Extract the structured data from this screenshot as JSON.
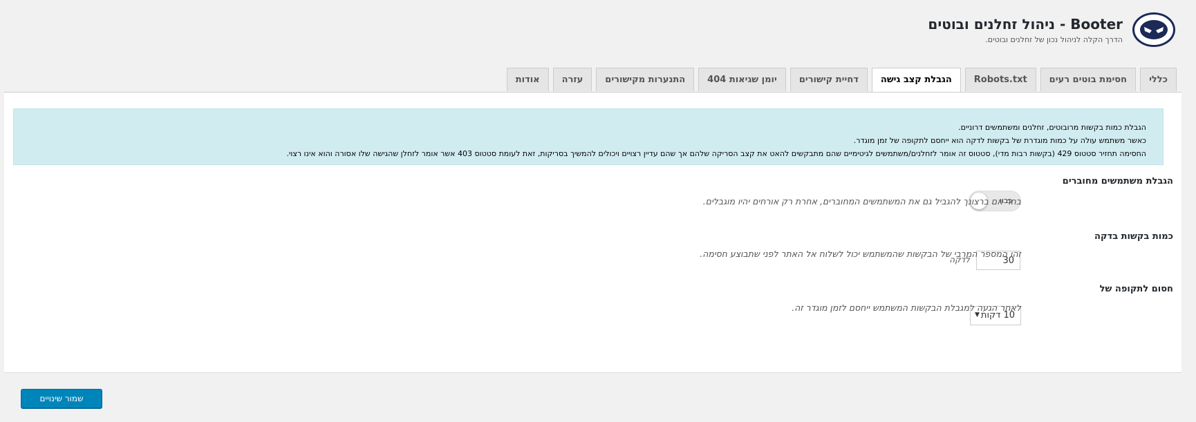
{
  "header": {
    "title": "Booter - ניהול זחלנים ובוטים",
    "subtitle": "הדרך הקלה לניהול נכון של זחלנים ובוטים."
  },
  "tabs": [
    {
      "label": "כללי",
      "active": false
    },
    {
      "label": "חסימת בוטים רעים",
      "active": false
    },
    {
      "label": "Robots.txt",
      "active": false
    },
    {
      "label": "הגבלת קצב גישה",
      "active": true
    },
    {
      "label": "דחיית קישורים",
      "active": false
    },
    {
      "label": "יומן שגיאות 404",
      "active": false
    },
    {
      "label": "התנערות מקישורים",
      "active": false
    },
    {
      "label": "עזרה",
      "active": false
    },
    {
      "label": "אודות",
      "active": false
    }
  ],
  "notice": {
    "line1": "הגבלת כמות בקשות מרובוטים, זחלנים ומשתמשים דרוניים.",
    "line2": "כאשר משתמש עולה על כמות מוגדרת של בקשות לדקה הוא ייחסם לתקופה של זמן מוגדר.",
    "line3": "החסימה תחזיר סטטוס 429 (בקשות רבות מדי), סטטוס זה אומר לזחלנים/משתמשים לגיטימיים שהם מתבקשים להאט את קצב הסריקה שלהם אך שהם עדיין רצויים ויכולים להמשיך בסריקות, זאת לעומת סטטוס 403 אשר אומר לזחלן שהגישה שלו אסורה והוא אינו רצוי."
  },
  "settings": {
    "logged_users": {
      "label": "הגבלת משתמשים מחוברים",
      "toggle_text": "כבוי",
      "enabled": false,
      "help": "בחר אם ברצונך להגביל גם את המשתמשים המחוברים, אחרת רק אורחים יהיו מוגבלים."
    },
    "requests_per_minute": {
      "label": "כמות בקשות בדקה",
      "value": "30",
      "unit": "לדקה",
      "help": "זהו המספר המרבי של הבקשות שהמשתמש יכול לשלוח אל האתר לפני שתבוצע חסימה."
    },
    "block_period": {
      "label": "חסום לתקופה של",
      "selected": "10 דקות",
      "help": "לאחר הגעה למגבלת הבקשות המשתמש ייחסם לזמן מוגדר זה."
    }
  },
  "footer": {
    "save_label": "שמור שינויים"
  },
  "colors": {
    "primary_button": "#0085ba",
    "notice_bg": "#d1ecf1",
    "logo_navy": "#1b2a56"
  },
  "icons": {
    "logo": "masked-face-logo-icon",
    "select_arrow": "triangle-down-icon"
  }
}
